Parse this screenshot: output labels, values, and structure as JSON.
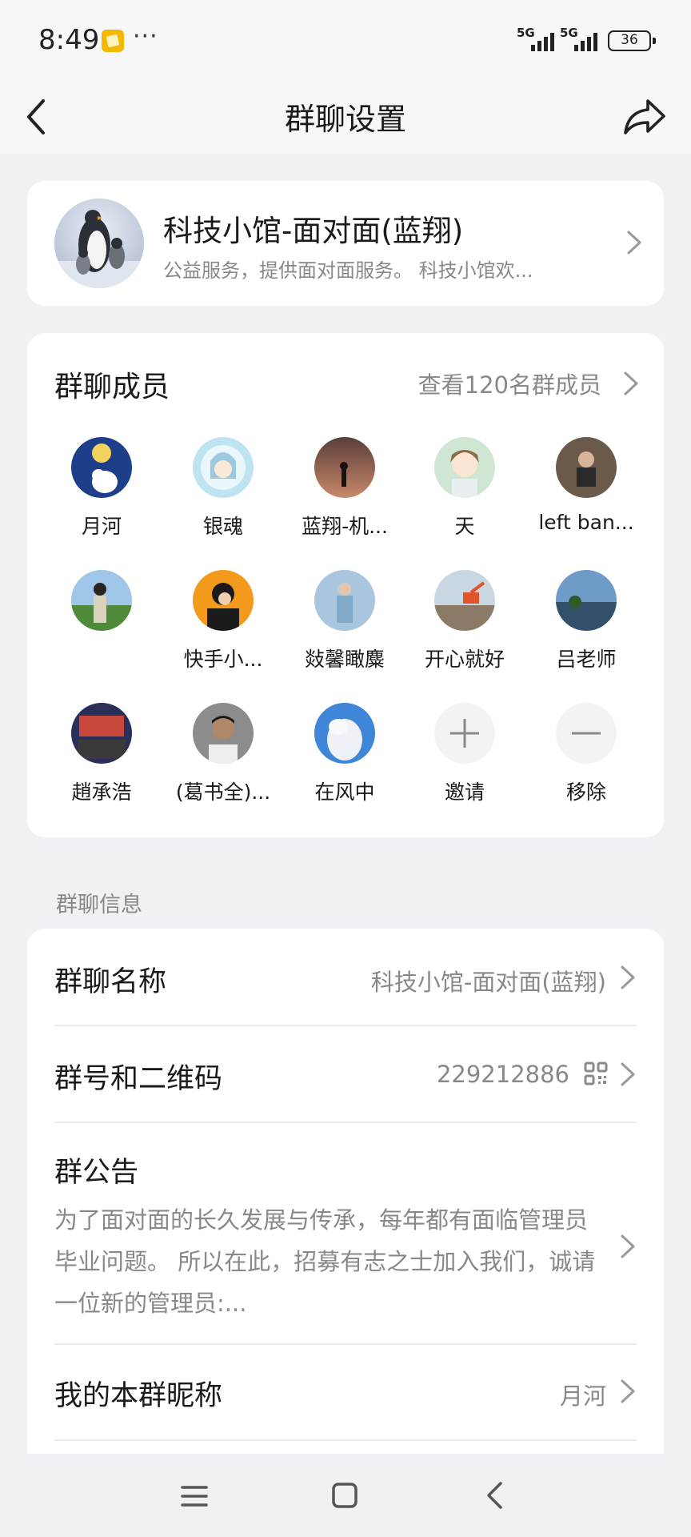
{
  "status_bar": {
    "time": "8:49",
    "dots": "···",
    "signal1_label": "5G",
    "signal2_label": "5G",
    "battery": "36"
  },
  "nav": {
    "title": "群聊设置"
  },
  "group": {
    "name": "科技小馆-面对面(蓝翔)",
    "description": "公益服务，提供面对面服务。 科技小馆欢..."
  },
  "members": {
    "title": "群聊成员",
    "view_all": "查看120名群成员",
    "items": [
      {
        "name": "月河"
      },
      {
        "name": "银魂"
      },
      {
        "name": "蓝翔-机..."
      },
      {
        "name": "天"
      },
      {
        "name": "left ban..."
      },
      {
        "name": ""
      },
      {
        "name": "快手小..."
      },
      {
        "name": "敥馨瞰麋"
      },
      {
        "name": "开心就好"
      },
      {
        "name": "吕老师"
      },
      {
        "name": "趙承浩"
      },
      {
        "name": "(葛书全)..."
      },
      {
        "name": "在风中"
      }
    ],
    "invite_label": "邀请",
    "remove_label": "移除"
  },
  "info": {
    "section_label": "群聊信息",
    "group_name_label": "群聊名称",
    "group_name_value": "科技小馆-面对面(蓝翔)",
    "group_id_label": "群号和二维码",
    "group_id_value": "229212886",
    "notice_label": "群公告",
    "notice_text": "为了面对面的长久发展与传承，每年都有面临管理员毕业问题。 所以在此，招募有志之士加入我们，诚请一位新的管理员:...",
    "nickname_label": "我的本群昵称",
    "nickname_value": "月河"
  }
}
